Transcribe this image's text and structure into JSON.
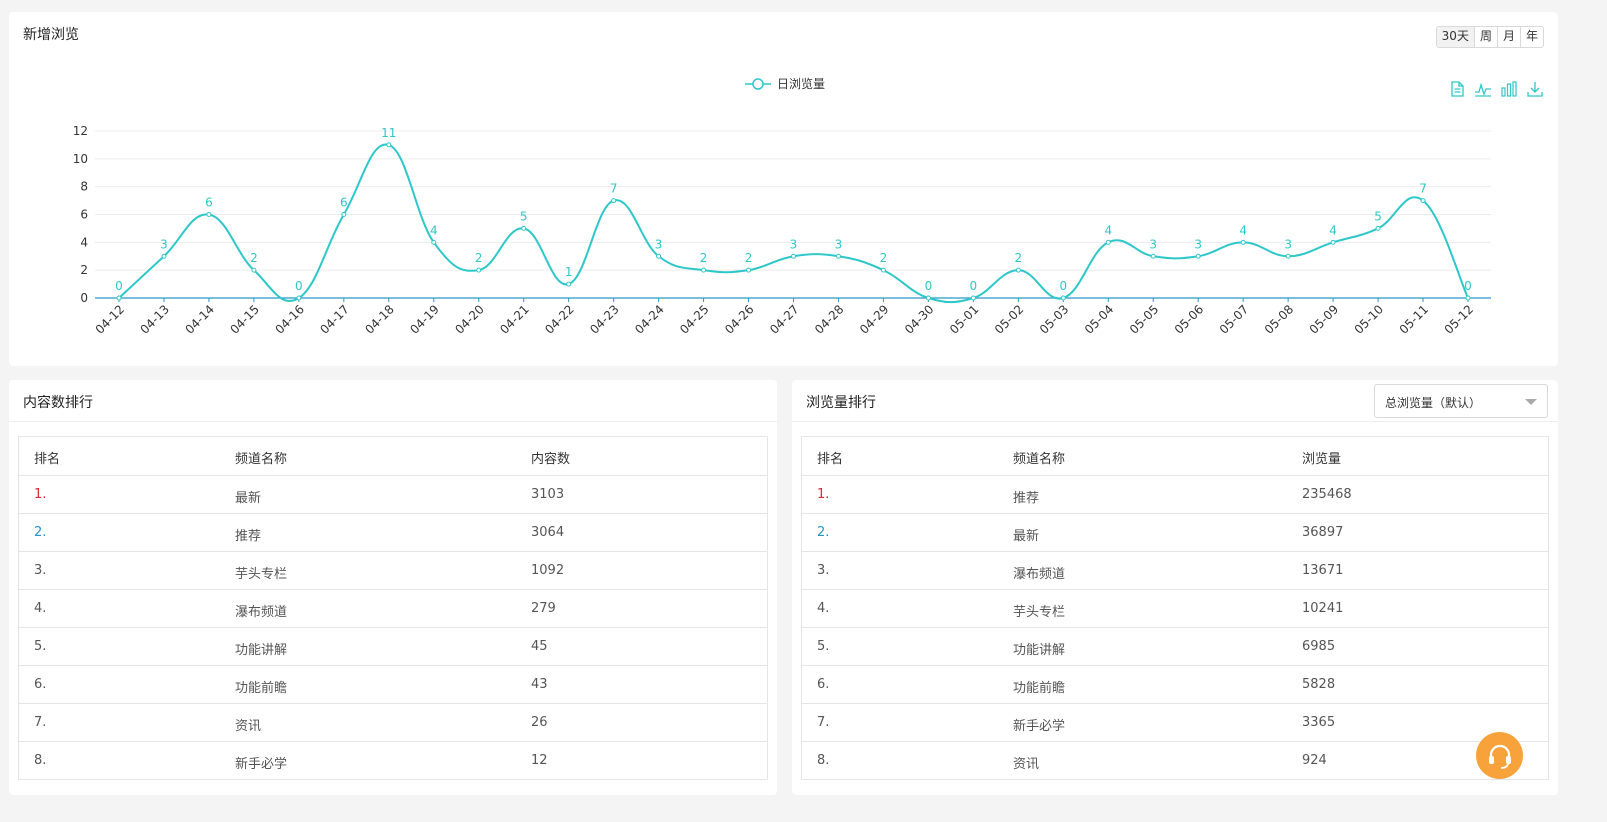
{
  "trend": {
    "title": "新增浏览",
    "range_buttons": [
      "30天",
      "周",
      "月",
      "年"
    ],
    "legend_label": "日浏览量",
    "toolbox_icons": [
      "data-view-icon",
      "line-chart-icon",
      "bar-chart-icon",
      "download-icon"
    ]
  },
  "chart_data": {
    "type": "line",
    "x": [
      "04-12",
      "04-13",
      "04-14",
      "04-15",
      "04-16",
      "04-17",
      "04-18",
      "04-19",
      "04-20",
      "04-21",
      "04-22",
      "04-23",
      "04-24",
      "04-25",
      "04-26",
      "04-27",
      "04-28",
      "04-29",
      "04-30",
      "05-01",
      "05-02",
      "05-03",
      "05-04",
      "05-05",
      "05-06",
      "05-07",
      "05-08",
      "05-09",
      "05-10",
      "05-11",
      "05-12"
    ],
    "series": [
      {
        "name": "日浏览量",
        "values": [
          0,
          3,
          6,
          2,
          0,
          6,
          11,
          4,
          2,
          5,
          1,
          7,
          3,
          2,
          2,
          3,
          3,
          2,
          0,
          0,
          2,
          0,
          4,
          3,
          3,
          4,
          3,
          4,
          5,
          7,
          0
        ]
      }
    ],
    "ylim": [
      0,
      12
    ],
    "yticks": [
      0,
      2,
      4,
      6,
      8,
      10,
      12
    ],
    "grid": true,
    "legend": "top-center",
    "color": "#2ec7c9"
  },
  "content_rank": {
    "title": "内容数排行",
    "headers": [
      "排名",
      "频道名称",
      "内容数"
    ],
    "rows": [
      [
        "1.",
        "最新",
        "3103"
      ],
      [
        "2.",
        "推荐",
        "3064"
      ],
      [
        "3.",
        "芋头专栏",
        "1092"
      ],
      [
        "4.",
        "瀑布频道",
        "279"
      ],
      [
        "5.",
        "功能讲解",
        "45"
      ],
      [
        "6.",
        "功能前瞻",
        "43"
      ],
      [
        "7.",
        "资讯",
        "26"
      ],
      [
        "8.",
        "新手必学",
        "12"
      ]
    ]
  },
  "view_rank": {
    "title": "浏览量排行",
    "select_value": "总浏览量（默认）",
    "headers": [
      "排名",
      "频道名称",
      "浏览量"
    ],
    "rows": [
      [
        "1.",
        "推荐",
        "235468"
      ],
      [
        "2.",
        "最新",
        "36897"
      ],
      [
        "3.",
        "瀑布频道",
        "13671"
      ],
      [
        "4.",
        "芋头专栏",
        "10241"
      ],
      [
        "5.",
        "功能讲解",
        "6985"
      ],
      [
        "6.",
        "功能前瞻",
        "5828"
      ],
      [
        "7.",
        "新手必学",
        "3365"
      ],
      [
        "8.",
        "资讯",
        "924"
      ]
    ]
  },
  "colors": {
    "accent": "#2ec7c9",
    "rank1": "#e6262e",
    "rank2": "#2196c9",
    "support": "#f7a23b"
  },
  "support_icon": "headset-icon"
}
